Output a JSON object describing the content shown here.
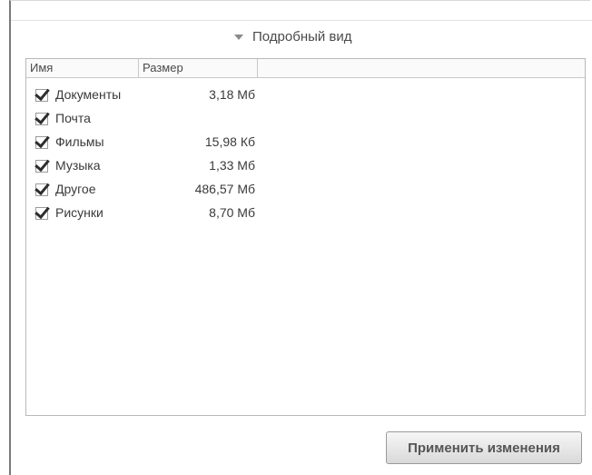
{
  "details_toggle": {
    "label": "Подробный вид",
    "icon": "triangle-down-icon"
  },
  "table": {
    "columns": [
      "Имя",
      "Размер",
      ""
    ],
    "rows": [
      {
        "name": "Документы",
        "size": "3,18 Мб",
        "checked": true
      },
      {
        "name": "Почта",
        "size": "",
        "checked": true
      },
      {
        "name": "Фильмы",
        "size": "15,98 Кб",
        "checked": true
      },
      {
        "name": "Музыка",
        "size": "1,33 Мб",
        "checked": true
      },
      {
        "name": "Другое",
        "size": "486,57 Мб",
        "checked": true
      },
      {
        "name": "Рисунки",
        "size": "8,70 Мб",
        "checked": true
      }
    ]
  },
  "apply_button": {
    "label": "Применить изменения"
  }
}
